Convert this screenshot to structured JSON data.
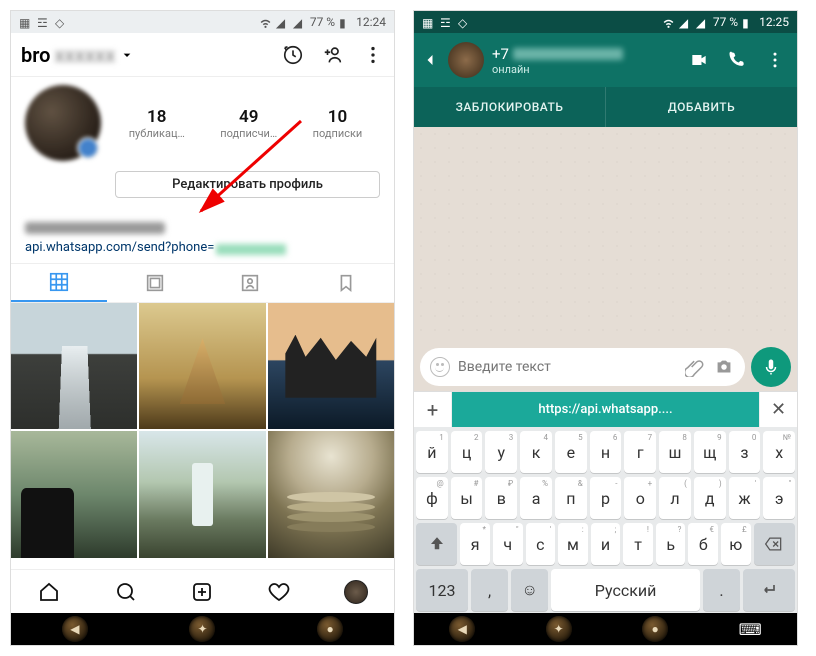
{
  "left": {
    "statusbar": {
      "battery": "77 %",
      "time": "12:24"
    },
    "header": {
      "username_prefix": "bro"
    },
    "stats": {
      "posts": {
        "count": "18",
        "label": "публикац…"
      },
      "followers": {
        "count": "49",
        "label": "подписчи…"
      },
      "following": {
        "count": "10",
        "label": "подписки"
      }
    },
    "edit_profile": "Редактировать профиль",
    "bio_link": "api.whatsapp.com/send?phone="
  },
  "right": {
    "statusbar": {
      "battery": "77 %",
      "time": "12:25"
    },
    "chat": {
      "name_prefix": "+7",
      "status": "онлайн",
      "block": "ЗАБЛОКИРОВАТЬ",
      "add": "ДОБАВИТЬ",
      "input_placeholder": "Введите текст"
    },
    "keyboard": {
      "suggestion": "https://api.whatsapp....",
      "rows": {
        "r1": [
          "й",
          "ц",
          "у",
          "к",
          "е",
          "н",
          "г",
          "ш",
          "щ",
          "з",
          "х"
        ],
        "r1sup": [
          "1",
          "2",
          "3",
          "4",
          "5",
          "6",
          "7",
          "8",
          "9",
          "0",
          "№"
        ],
        "r2": [
          "ф",
          "ы",
          "в",
          "а",
          "п",
          "р",
          "о",
          "л",
          "д",
          "ж",
          "э"
        ],
        "r2sup": [
          "@",
          "#",
          "₽",
          "%",
          "&",
          "-",
          "+",
          "(",
          ")",
          "'",
          "\""
        ],
        "r3": [
          "я",
          "ч",
          "с",
          "м",
          "и",
          "т",
          "ь",
          "б",
          "ю"
        ],
        "r3sup": [
          "*",
          "\"",
          "'",
          ":",
          ";",
          "!",
          "?",
          "€",
          "£"
        ]
      },
      "numkey": "123",
      "space": "Русский"
    }
  }
}
